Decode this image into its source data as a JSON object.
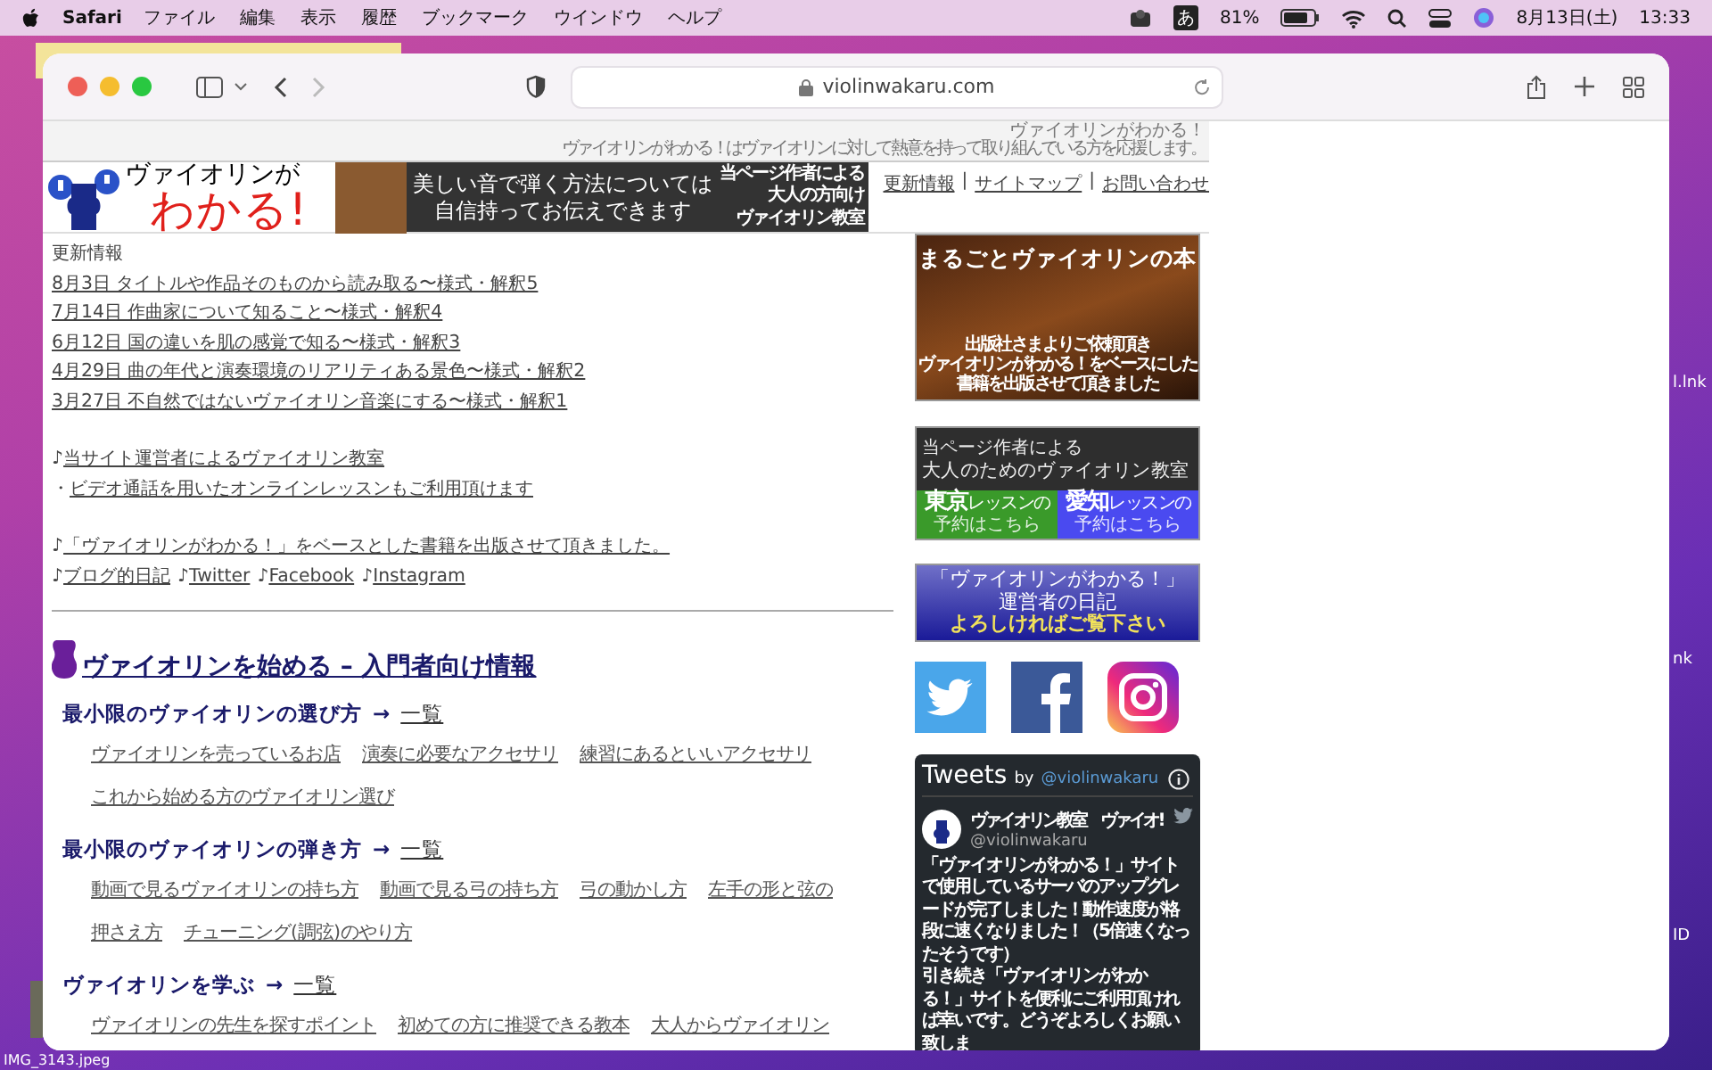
{
  "menubar": {
    "app": "Safari",
    "menus": [
      "ファイル",
      "編集",
      "表示",
      "履歴",
      "ブックマーク",
      "ウインドウ",
      "ヘルプ"
    ],
    "input_mode": "あ",
    "battery": "81%",
    "date": "8月13日(土)",
    "time": "13:33"
  },
  "desktop": {
    "labels": [
      "l.lnk",
      "nk",
      "ID"
    ],
    "file_label": "IMG_3143.jpeg"
  },
  "browser": {
    "url": "violinwakaru.com"
  },
  "site": {
    "tagline_title": "ヴァイオリンがわかる！",
    "tagline": "ヴァイオリンがわかる！はヴァイオリンに対して熱意を持って取り組んでいる方を応援します。",
    "logo": {
      "line1": "ヴァイオリンが",
      "line2": "わかる!"
    },
    "banner": {
      "main": [
        "美しい音で弾く方法については",
        "自信持ってお伝えできます"
      ],
      "side": [
        "当ページ作者による",
        "大人の方向け",
        "ヴァイオリン教室"
      ]
    },
    "header_links": [
      "更新情報",
      "サイトマップ",
      "お問い合わせ"
    ],
    "separator": "|",
    "updates": {
      "heading": "更新情報",
      "items": [
        "8月3日 タイトルや作品そのものから読み取る〜様式・解釈5",
        "7月14日 作曲家について知ること〜様式・解釈4",
        "6月12日 国の違いを肌の感覚で知る〜様式・解釈3",
        "4月29日 曲の年代と演奏環境のリアリティある景色〜様式・解釈2",
        "3月27日 不自然ではないヴァイオリン音楽にする〜様式・解釈1"
      ]
    },
    "notices": [
      [
        [
          {
            "prefix": "♪",
            "text": "当サイト運営者によるヴァイオリン教室"
          }
        ],
        [
          {
            "prefix": "・",
            "text": "ビデオ通話を用いたオンラインレッスンもご利用頂けます"
          }
        ]
      ],
      [
        [
          {
            "prefix": "♪",
            "text": "「ヴァイオリンがわかる！」をベースとした書籍を出版させて頂きました。"
          }
        ],
        [
          {
            "prefix": "♪",
            "text": "ブログ的日記"
          },
          {
            "prefix": "♪",
            "text": "Twitter"
          },
          {
            "prefix": "♪",
            "text": "Facebook"
          },
          {
            "prefix": "♪",
            "text": "Instagram"
          }
        ]
      ]
    ],
    "section": {
      "title": "ヴァイオリンを始める – 入門者向け情報",
      "subsections": [
        {
          "title": "最小限のヴァイオリンの選び方",
          "arrow": "→",
          "link": "一覧",
          "links": [
            "ヴァイオリンを売っているお店",
            "演奏に必要なアクセサリ",
            "練習にあるといいアクセサリ",
            "これから始める方のヴァイオリン選び"
          ]
        },
        {
          "title": "最小限のヴァイオリンの弾き方",
          "arrow": "→",
          "link": "一覧",
          "links": [
            "動画で見るヴァイオリンの持ち方",
            "動画で見る弓の持ち方",
            "弓の動かし方",
            "左手の形と弦の",
            "押さえ方",
            "チューニング(調弦)のやり方"
          ]
        },
        {
          "title": "ヴァイオリンを学ぶ",
          "arrow": "→",
          "link": "一覧",
          "links": [
            "ヴァイオリンの先生を探すポイント",
            "初めての方に推奨できる教本",
            "大人からヴァイオリン"
          ]
        }
      ]
    }
  },
  "sidebar": {
    "book_banner": {
      "title": "まるごとヴァイオリンの本",
      "caption": [
        "出版社さまよりご依頼頂き",
        "ヴァイオリンがわかる！をベースにした",
        "書籍を出版させて頂きました"
      ]
    },
    "lesson_banner": {
      "lines": [
        "当ページ作者による",
        "大人のためのヴァイオリン教室"
      ],
      "buttons": [
        {
          "city": "東京",
          "sub1": "レッスンの",
          "sub2": "予約はこちら",
          "color": "#3a9a2a"
        },
        {
          "city": "愛知",
          "sub1": "レッスンの",
          "sub2": "予約はこちら",
          "color": "#4a4af0"
        }
      ]
    },
    "diary_banner": {
      "lines": [
        "「ヴァイオリンがわかる！」",
        "運営者の日記",
        "よろしければご覧下さい"
      ]
    },
    "tweets": {
      "title": "Tweets",
      "by": "by",
      "handle": "@violinwakaru",
      "author": "ヴァイオリン教室　ヴァイオ!",
      "author_handle": "@violinwakaru",
      "paragraphs": [
        "「ヴァイオリンがわかる！」サイトで使用しているサーバのアップグレードが完了しました！動作速度が格段に速くなりました！（5倍速くなったそうです）",
        "引き続き「ヴァイオリンがわかる！」サイトを便利にご利用頂ければ幸いです。どうぞよろしくお願い致しま"
      ]
    }
  }
}
